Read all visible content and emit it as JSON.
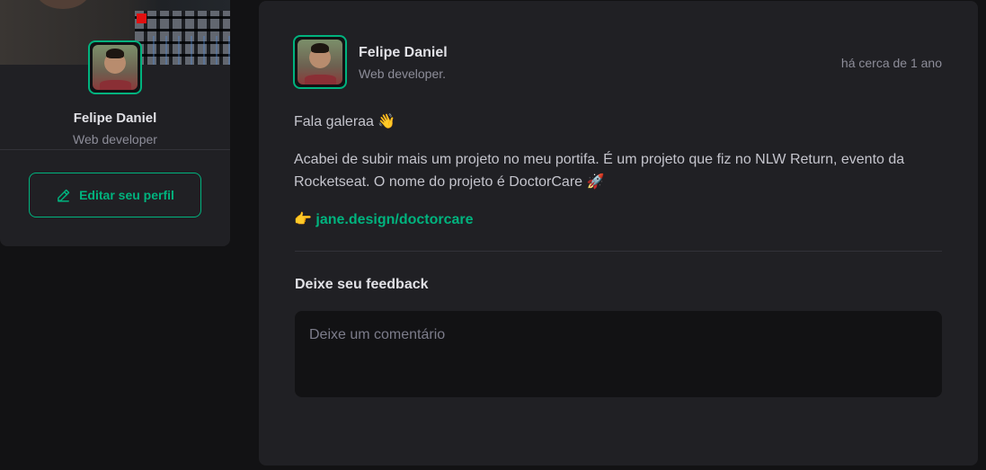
{
  "sidebar": {
    "profile": {
      "name": "Felipe Daniel",
      "role": "Web developer"
    },
    "edit_button_label": "Editar seu perfil",
    "edit_icon": "pencil-icon"
  },
  "post": {
    "author": {
      "name": "Felipe Daniel",
      "role": "Web developer."
    },
    "published_at": "há cerca de 1 ano",
    "content": {
      "greeting": "Fala galeraa 👋",
      "body": "Acabei de subir mais um projeto no meu portifa. É um projeto que fiz no NLW Return, evento da Rocketseat. O nome do projeto é DoctorCare 🚀",
      "link_prefix": "👉 ",
      "link_text": "jane.design/doctorcare"
    }
  },
  "feedback": {
    "title": "Deixe seu feedback",
    "placeholder": "Deixe um comentário",
    "value": ""
  },
  "colors": {
    "accent": "#00B37E",
    "card_background": "#202024",
    "page_background": "#121214"
  }
}
